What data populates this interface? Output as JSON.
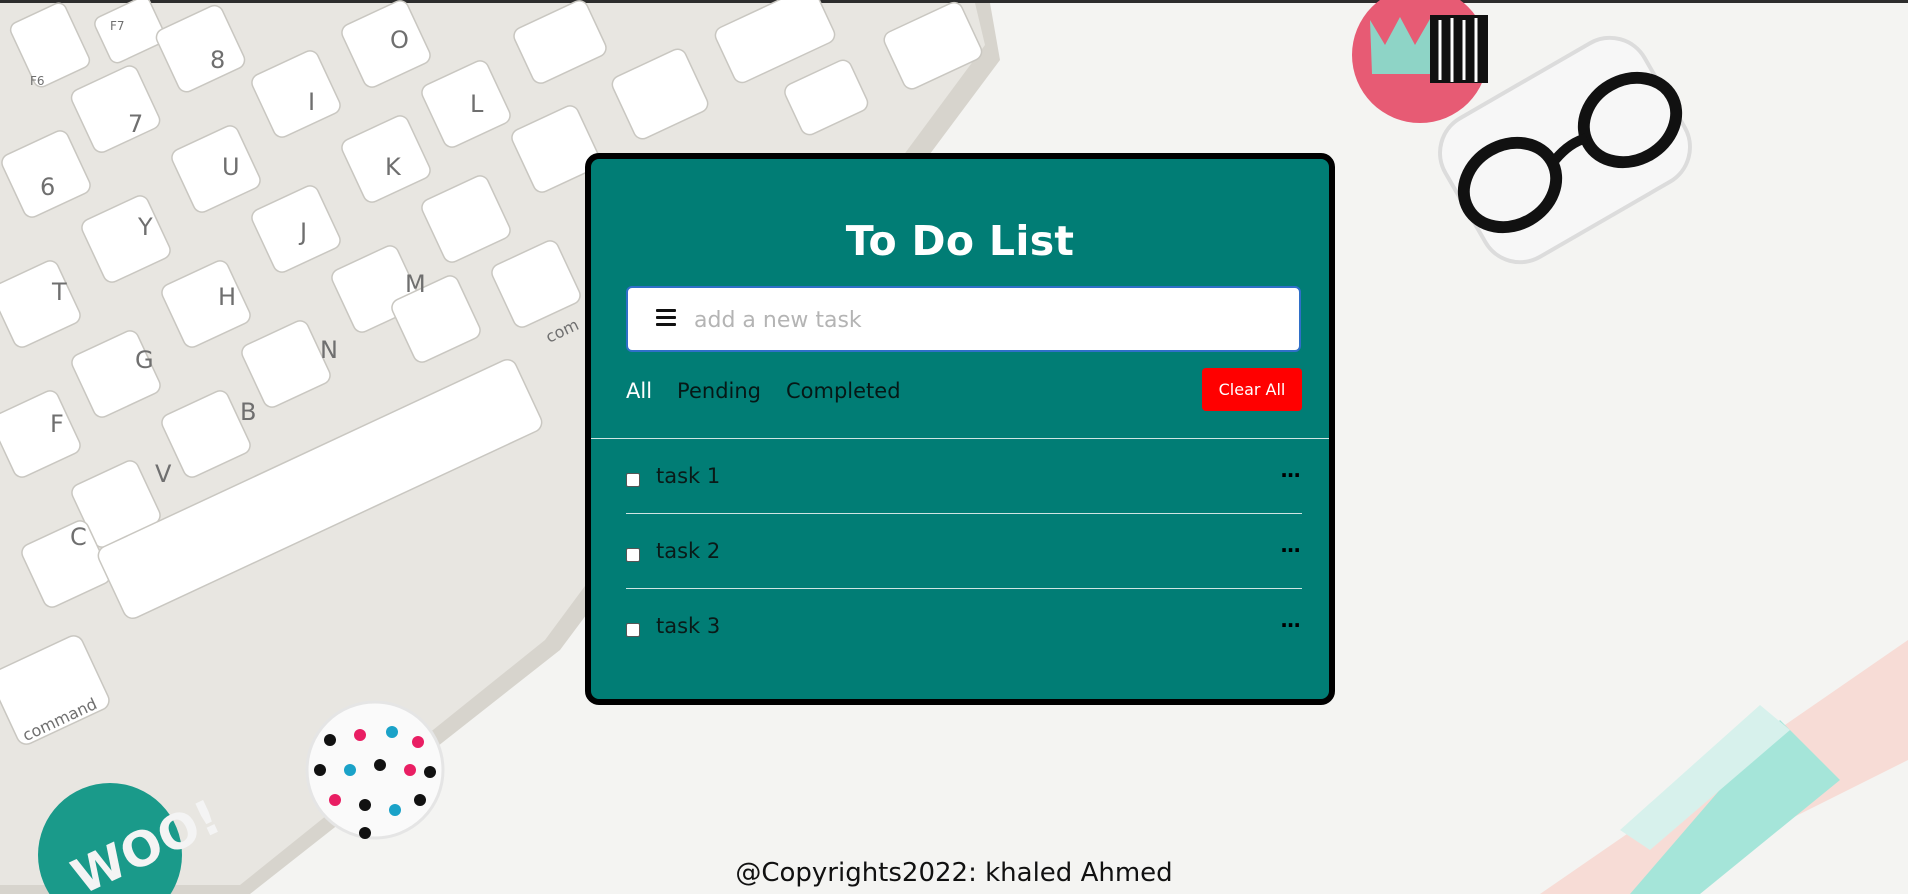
{
  "app": {
    "title": "To Do List"
  },
  "input": {
    "placeholder": "add a new task",
    "icon": "menu-icon"
  },
  "filters": [
    {
      "label": "All",
      "active": true
    },
    {
      "label": "Pending",
      "active": false
    },
    {
      "label": "Completed",
      "active": false
    }
  ],
  "clear_label": "Clear All",
  "tasks": [
    {
      "label": "task 1",
      "checked": false,
      "menu": "···"
    },
    {
      "label": "task 2",
      "checked": false,
      "menu": "···"
    },
    {
      "label": "task 3",
      "checked": false,
      "menu": "···"
    }
  ],
  "footer": "@Copyrights2022: khaled Ahmed",
  "background": {
    "keyboard_keys": [
      "F7",
      "F6",
      "8",
      "7",
      "6",
      "O",
      "I",
      "U",
      "Y",
      "T",
      "L",
      "K",
      "J",
      "H",
      "G",
      "F",
      "M",
      "N",
      "B",
      "V",
      "C",
      "command",
      "com"
    ],
    "badge_text": "WOO!"
  },
  "colors": {
    "card": "#017d75",
    "clear_button": "#ff0000",
    "input_border": "#2f6fc8"
  }
}
